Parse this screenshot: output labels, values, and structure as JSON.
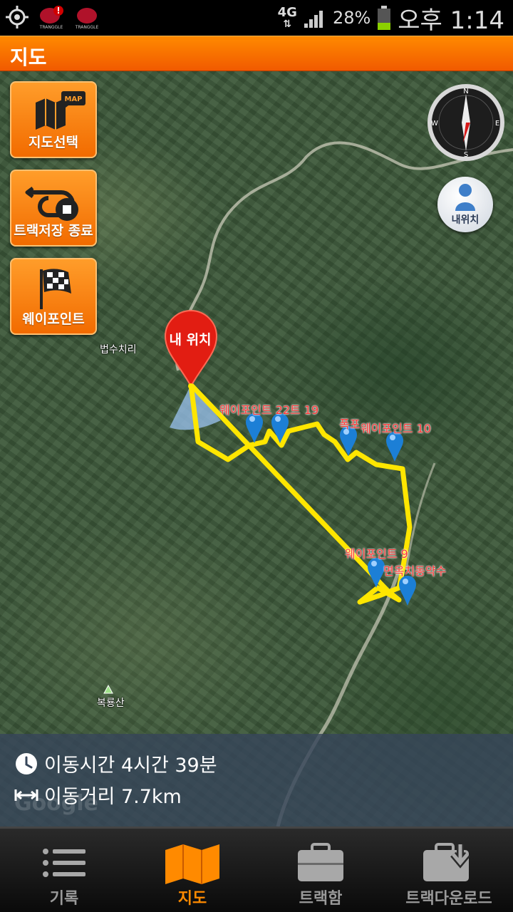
{
  "status_bar": {
    "network": "4G",
    "battery": "28%",
    "time": "오후 1:14",
    "notification_label": "TRANGGLE"
  },
  "header": {
    "title": "지도"
  },
  "map": {
    "buttons": {
      "select_map": "지도선택",
      "map_badge": "MAP",
      "end_track_save": "트랙저장 종료",
      "waypoint": "웨이포인트"
    },
    "my_location_button": "내위치",
    "my_location_pin": "내 위치",
    "compass": {
      "n": "N",
      "s": "S",
      "e": "E",
      "w": "W"
    },
    "place_labels": {
      "village": "법수치리",
      "mountain": "복룡산"
    },
    "waypoints": {
      "wp_22_19": "웨이포인트 22트 19",
      "waterfall": "폭포",
      "wp_10": "웨이포인트 10",
      "wp_9": "웨이포인트 9",
      "mineral_spring": "면옥치동약수"
    },
    "watermark": "Google"
  },
  "info": {
    "travel_time": "이동시간 4시간 39분",
    "travel_distance": "이동거리 7.7km"
  },
  "nav": {
    "records": "기록",
    "map": "지도",
    "trackbox": "트랙함",
    "track_download": "트랙다운로드"
  },
  "colors": {
    "accent": "#ff8a00",
    "track": "#ffe600",
    "waypoint_text": "#ff3a3a"
  }
}
